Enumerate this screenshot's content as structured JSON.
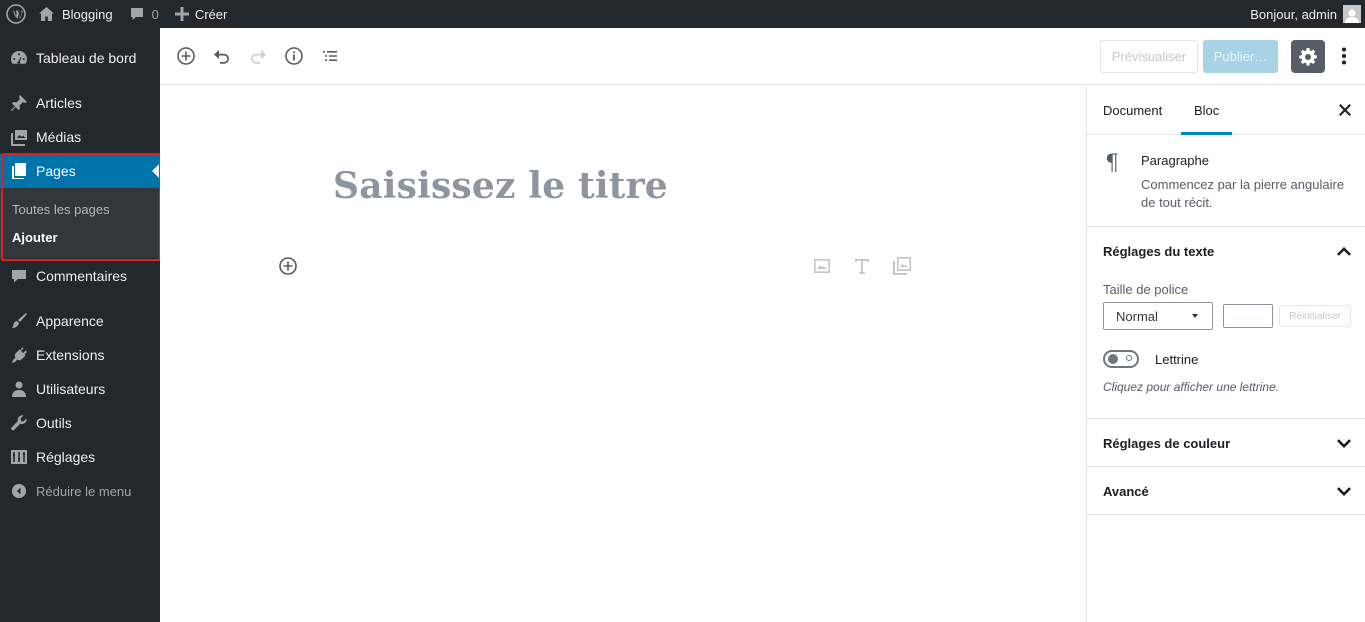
{
  "admin_bar": {
    "site_name": "Blogging",
    "comments_count": "0",
    "new_label": "Créer",
    "greeting": "Bonjour, admin"
  },
  "sidebar": {
    "items": [
      {
        "label": "Tableau de bord",
        "icon": "dashboard-icon"
      },
      {
        "label": "Articles",
        "icon": "pin-icon"
      },
      {
        "label": "Médias",
        "icon": "media-icon"
      },
      {
        "label": "Pages",
        "icon": "pages-icon",
        "current": true
      },
      {
        "label": "Commentaires",
        "icon": "comment-icon"
      },
      {
        "label": "Apparence",
        "icon": "brush-icon"
      },
      {
        "label": "Extensions",
        "icon": "plugin-icon"
      },
      {
        "label": "Utilisateurs",
        "icon": "user-icon"
      },
      {
        "label": "Outils",
        "icon": "wrench-icon"
      },
      {
        "label": "Réglages",
        "icon": "settings-sliders-icon"
      }
    ],
    "submenu": {
      "all_pages": "Toutes les pages",
      "add_new": "Ajouter"
    },
    "collapse_label": "Réduire le menu"
  },
  "editor_header": {
    "preview_label": "Prévisualiser",
    "publish_label": "Publier…"
  },
  "content": {
    "title_placeholder": "Saisissez le titre"
  },
  "panel": {
    "tabs": {
      "document": "Document",
      "block": "Bloc"
    },
    "block_card": {
      "title": "Paragraphe",
      "description": "Commencez par la pierre angulaire de tout récit."
    },
    "text_settings": {
      "title": "Réglages du texte",
      "font_size_label": "Taille de police",
      "font_size_value": "Normal",
      "custom_size_value": "",
      "reset_label": "Réinitialiser",
      "dropcap_label": "Lettrine",
      "dropcap_help": "Cliquez pour afficher une lettrine."
    },
    "color_settings": {
      "title": "Réglages de couleur"
    },
    "advanced": {
      "title": "Avancé"
    }
  },
  "colors": {
    "admin_dark": "#23282d",
    "accent_blue": "#0073aa",
    "publish_disabled": "#a8d2e5",
    "highlight_red": "#e02020"
  }
}
